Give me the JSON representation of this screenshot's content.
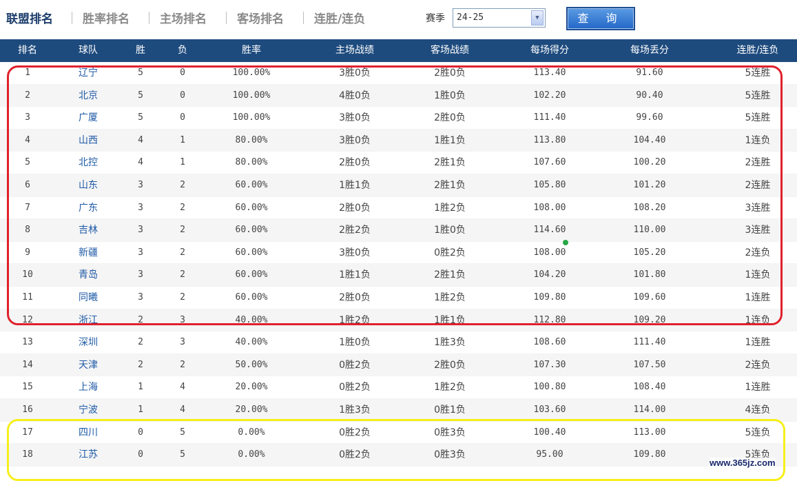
{
  "tabs": [
    {
      "label": "联盟排名",
      "active": true
    },
    {
      "label": "胜率排名",
      "active": false
    },
    {
      "label": "主场排名",
      "active": false
    },
    {
      "label": "客场排名",
      "active": false
    },
    {
      "label": "连胜/连负",
      "active": false
    }
  ],
  "season": {
    "label": "赛季",
    "value": "24-25"
  },
  "query_button": "查 询",
  "columns": [
    "排名",
    "球队",
    "胜",
    "负",
    "胜率",
    "主场战绩",
    "客场战绩",
    "每场得分",
    "每场丢分",
    "连胜/连负"
  ],
  "rows": [
    {
      "rank": "1",
      "team": "辽宁",
      "w": "5",
      "l": "0",
      "pct": "100.00%",
      "home": "3胜0负",
      "away": "2胜0负",
      "ppg": "113.40",
      "oppg": "91.60",
      "streak": "5连胜"
    },
    {
      "rank": "2",
      "team": "北京",
      "w": "5",
      "l": "0",
      "pct": "100.00%",
      "home": "4胜0负",
      "away": "1胜0负",
      "ppg": "102.20",
      "oppg": "90.40",
      "streak": "5连胜"
    },
    {
      "rank": "3",
      "team": "广厦",
      "w": "5",
      "l": "0",
      "pct": "100.00%",
      "home": "3胜0负",
      "away": "2胜0负",
      "ppg": "111.40",
      "oppg": "99.60",
      "streak": "5连胜"
    },
    {
      "rank": "4",
      "team": "山西",
      "w": "4",
      "l": "1",
      "pct": "80.00%",
      "home": "3胜0负",
      "away": "1胜1负",
      "ppg": "113.80",
      "oppg": "104.40",
      "streak": "1连负"
    },
    {
      "rank": "5",
      "team": "北控",
      "w": "4",
      "l": "1",
      "pct": "80.00%",
      "home": "2胜0负",
      "away": "2胜1负",
      "ppg": "107.60",
      "oppg": "100.20",
      "streak": "2连胜"
    },
    {
      "rank": "6",
      "team": "山东",
      "w": "3",
      "l": "2",
      "pct": "60.00%",
      "home": "1胜1负",
      "away": "2胜1负",
      "ppg": "105.80",
      "oppg": "101.20",
      "streak": "2连胜"
    },
    {
      "rank": "7",
      "team": "广东",
      "w": "3",
      "l": "2",
      "pct": "60.00%",
      "home": "2胜0负",
      "away": "1胜2负",
      "ppg": "108.00",
      "oppg": "108.20",
      "streak": "3连胜"
    },
    {
      "rank": "8",
      "team": "吉林",
      "w": "3",
      "l": "2",
      "pct": "60.00%",
      "home": "2胜2负",
      "away": "1胜0负",
      "ppg": "114.60",
      "oppg": "110.00",
      "streak": "3连胜"
    },
    {
      "rank": "9",
      "team": "新疆",
      "w": "3",
      "l": "2",
      "pct": "60.00%",
      "home": "3胜0负",
      "away": "0胜2负",
      "ppg": "108.00",
      "oppg": "105.20",
      "streak": "2连负"
    },
    {
      "rank": "10",
      "team": "青岛",
      "w": "3",
      "l": "2",
      "pct": "60.00%",
      "home": "1胜1负",
      "away": "2胜1负",
      "ppg": "104.20",
      "oppg": "101.80",
      "streak": "1连负"
    },
    {
      "rank": "11",
      "team": "同曦",
      "w": "3",
      "l": "2",
      "pct": "60.00%",
      "home": "2胜0负",
      "away": "1胜2负",
      "ppg": "109.80",
      "oppg": "109.60",
      "streak": "1连胜"
    },
    {
      "rank": "12",
      "team": "浙江",
      "w": "2",
      "l": "3",
      "pct": "40.00%",
      "home": "1胜2负",
      "away": "1胜1负",
      "ppg": "112.80",
      "oppg": "109.20",
      "streak": "1连负"
    },
    {
      "rank": "13",
      "team": "深圳",
      "w": "2",
      "l": "3",
      "pct": "40.00%",
      "home": "1胜0负",
      "away": "1胜3负",
      "ppg": "108.60",
      "oppg": "111.40",
      "streak": "1连胜"
    },
    {
      "rank": "14",
      "team": "天津",
      "w": "2",
      "l": "2",
      "pct": "50.00%",
      "home": "0胜2负",
      "away": "2胜0负",
      "ppg": "107.30",
      "oppg": "107.50",
      "streak": "2连负"
    },
    {
      "rank": "15",
      "team": "上海",
      "w": "1",
      "l": "4",
      "pct": "20.00%",
      "home": "0胜2负",
      "away": "1胜2负",
      "ppg": "100.80",
      "oppg": "108.40",
      "streak": "1连胜"
    },
    {
      "rank": "16",
      "team": "宁波",
      "w": "1",
      "l": "4",
      "pct": "20.00%",
      "home": "1胜3负",
      "away": "0胜1负",
      "ppg": "103.60",
      "oppg": "114.00",
      "streak": "4连负"
    },
    {
      "rank": "17",
      "team": "四川",
      "w": "0",
      "l": "5",
      "pct": "0.00%",
      "home": "0胜2负",
      "away": "0胜3负",
      "ppg": "100.40",
      "oppg": "113.00",
      "streak": "5连负"
    },
    {
      "rank": "18",
      "team": "江苏",
      "w": "0",
      "l": "5",
      "pct": "0.00%",
      "home": "0胜2负",
      "away": "0胜3负",
      "ppg": "95.00",
      "oppg": "109.80",
      "streak": "5连负"
    }
  ],
  "watermark": "www.365jz.com",
  "colors": {
    "header_bg": "#1e4b7e",
    "team_link": "#1f5aa6",
    "highlight_top": "#e0202c",
    "highlight_bottom": "#f6ef1a"
  }
}
